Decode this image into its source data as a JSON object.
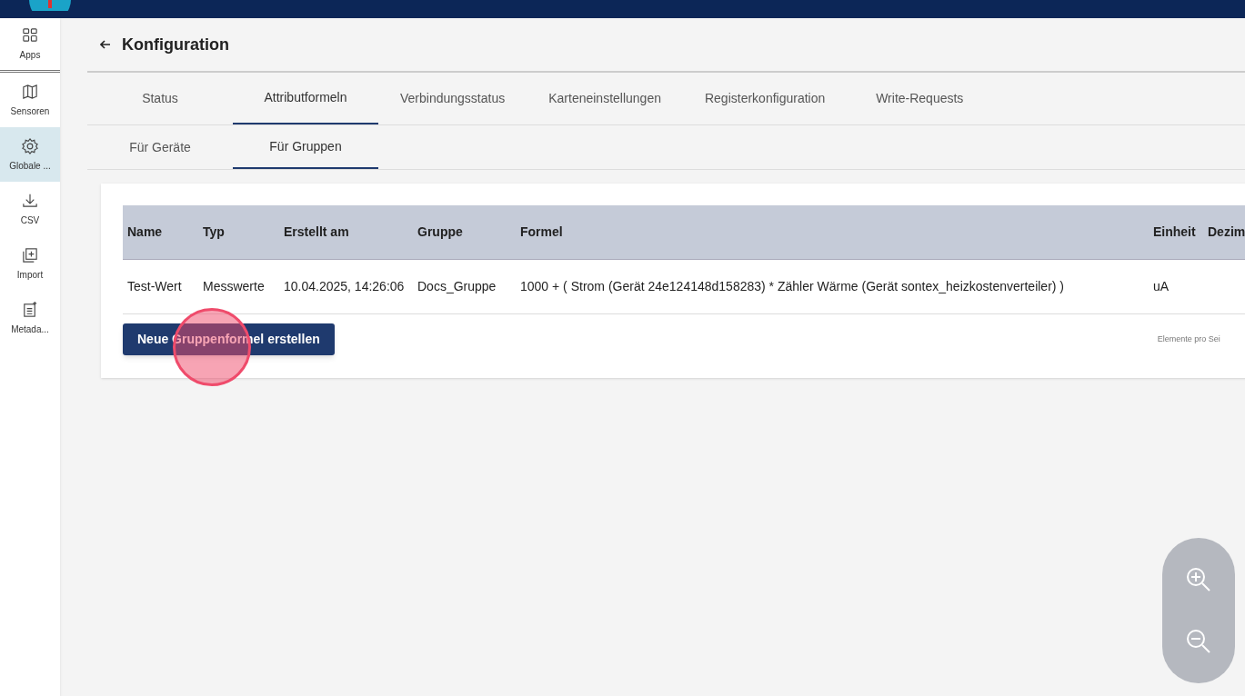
{
  "sidebar": {
    "items": [
      {
        "label": "Apps",
        "selected": false
      },
      {
        "label": "Sensoren",
        "selected": false
      },
      {
        "label": "Globale ...",
        "selected": true
      },
      {
        "label": "CSV",
        "selected": false
      },
      {
        "label": "Import",
        "selected": false
      },
      {
        "label": "Metada...",
        "selected": false
      }
    ]
  },
  "page": {
    "title": "Konfiguration"
  },
  "tabs": [
    {
      "label": "Status",
      "selected": false
    },
    {
      "label": "Attributformeln",
      "selected": true
    },
    {
      "label": "Verbindungsstatus",
      "selected": false
    },
    {
      "label": "Karteneinstellungen",
      "selected": false
    },
    {
      "label": "Registerkonfiguration",
      "selected": false
    },
    {
      "label": "Write-Requests",
      "selected": false
    }
  ],
  "subtabs": [
    {
      "label": "Für Geräte",
      "selected": false
    },
    {
      "label": "Für Gruppen",
      "selected": true
    }
  ],
  "table": {
    "columns": [
      "Name",
      "Typ",
      "Erstellt am",
      "Gruppe",
      "Formel",
      "Einheit",
      "Dezim"
    ],
    "rows": [
      [
        "Test-Wert",
        "Messwerte",
        "10.04.2025, 14:26:06",
        "Docs_Gruppe",
        "1000 + ( Strom (Gerät 24e124148d158283) * Zähler Wärme (Gerät sontex_heizkostenverteiler) )",
        "uA"
      ]
    ]
  },
  "create_button": "Neue Gruppenformel erstellen",
  "pagination": {
    "label": "Elemente pro Sei"
  }
}
